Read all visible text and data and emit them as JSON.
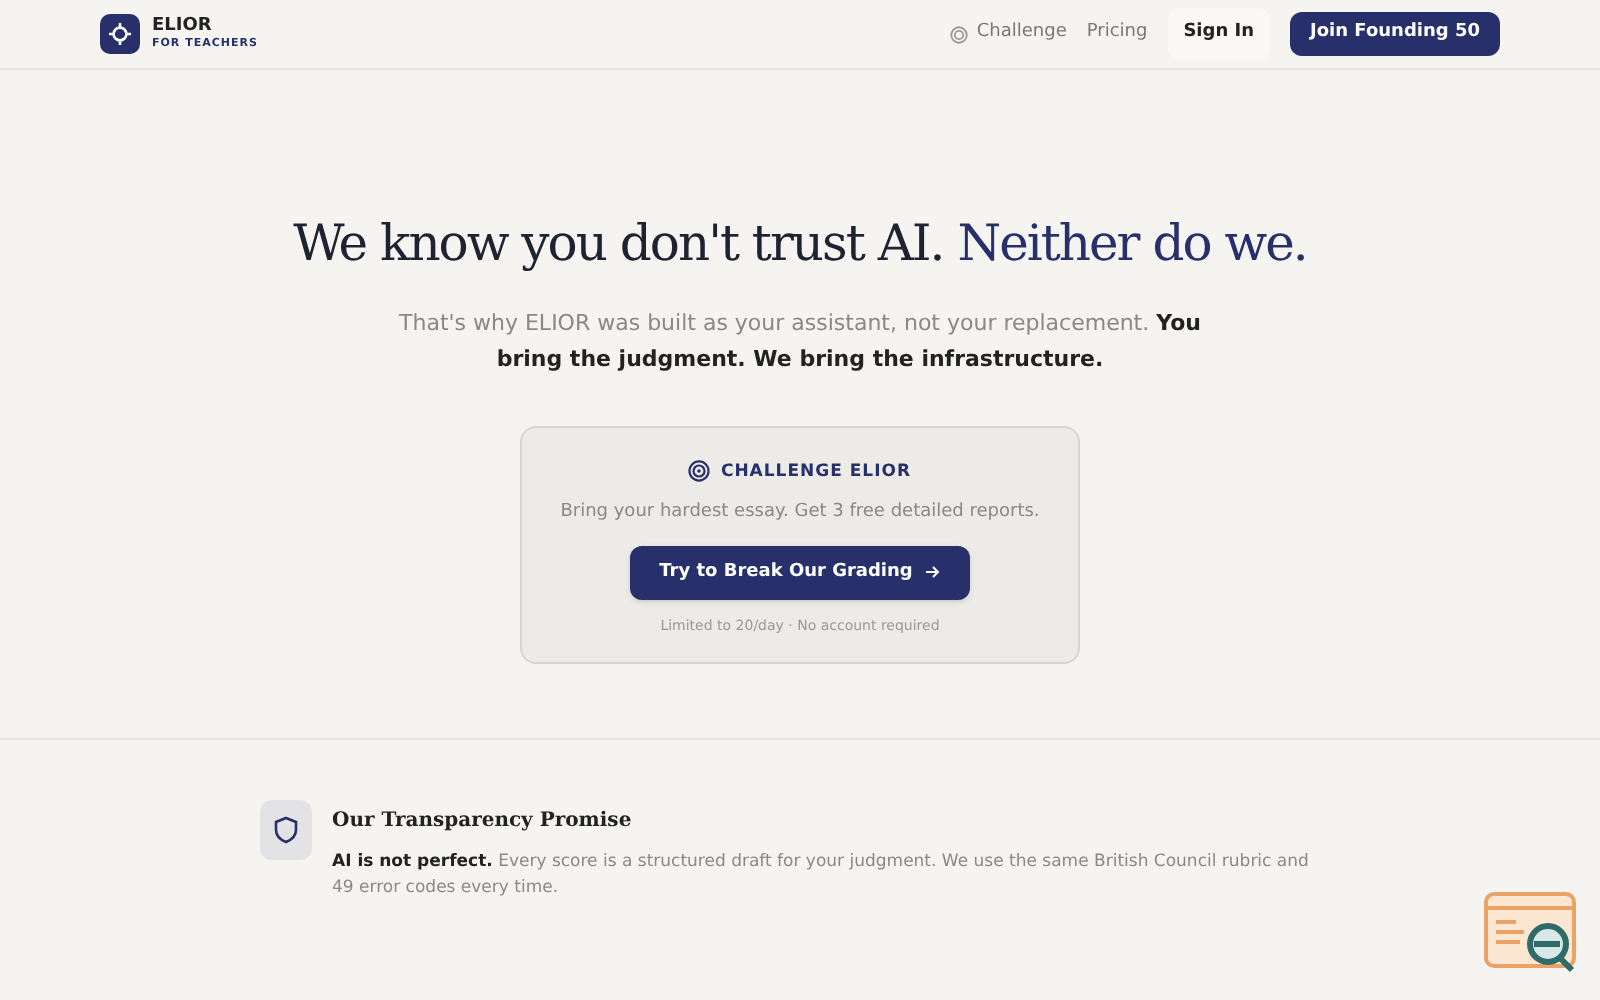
{
  "brand": {
    "name": "ELIOR",
    "tagline": "FOR TEACHERS"
  },
  "nav": {
    "links": [
      "Challenge",
      "Pricing"
    ],
    "sign_in": "Sign In",
    "cta": "Join Founding 50"
  },
  "hero": {
    "title": "We know you don't trust AI.",
    "title_accent": "Neither do we.",
    "subtitle": "That's why ELIOR was built as your assistant, not your replacement. **You bring the judgment. We bring the infrastructure.**"
  },
  "challenge": {
    "heading": "CHALLENGE ELIOR",
    "text": "Bring your hardest essay. Get 3 free detailed reports.",
    "button": "Try to Break Our Grading",
    "note": "Limited to 20/day · No account required"
  },
  "promise": {
    "title": "Our Transparency Promise",
    "text": "**AI is not perfect.** Every score is a structured draft for your judgment. We use the same British Council rubric and 49 error codes every time."
  }
}
